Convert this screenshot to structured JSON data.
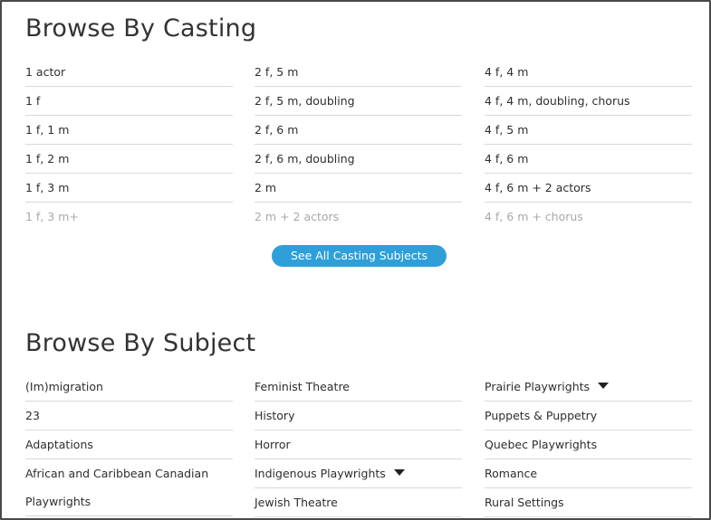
{
  "casting": {
    "title": "Browse By Casting",
    "columns": [
      [
        "1 actor",
        "1 f",
        "1 f, 1 m",
        "1 f, 2 m",
        "1 f, 3 m",
        "1 f, 3 m+"
      ],
      [
        "2 f, 5 m",
        "2 f, 5 m, doubling",
        "2 f, 6 m",
        "2 f, 6 m, doubling",
        "2 m",
        "2 m + 2 actors"
      ],
      [
        "4 f, 4 m",
        "4 f, 4 m, doubling, chorus",
        "4 f, 5 m",
        "4 f, 6 m",
        "4 f, 6 m + 2 actors",
        "4 f, 6 m + chorus"
      ]
    ],
    "see_all_label": "See All Casting Subjects"
  },
  "subject": {
    "title": "Browse By Subject",
    "columns": [
      [
        "(Im)migration",
        "23",
        "Adaptations",
        "African and Caribbean Canadian",
        "Playwrights"
      ],
      [
        "Feminist Theatre",
        "History",
        "Horror",
        "Indigenous Playwrights",
        "Jewish Theatre"
      ],
      [
        "Prairie Playwrights",
        "Puppets & Puppetry",
        "Quebec Playwrights",
        "Romance",
        "Rural Settings"
      ]
    ],
    "dropdown_items": [
      "Indigenous Playwrights",
      "Prairie Playwrights"
    ]
  }
}
